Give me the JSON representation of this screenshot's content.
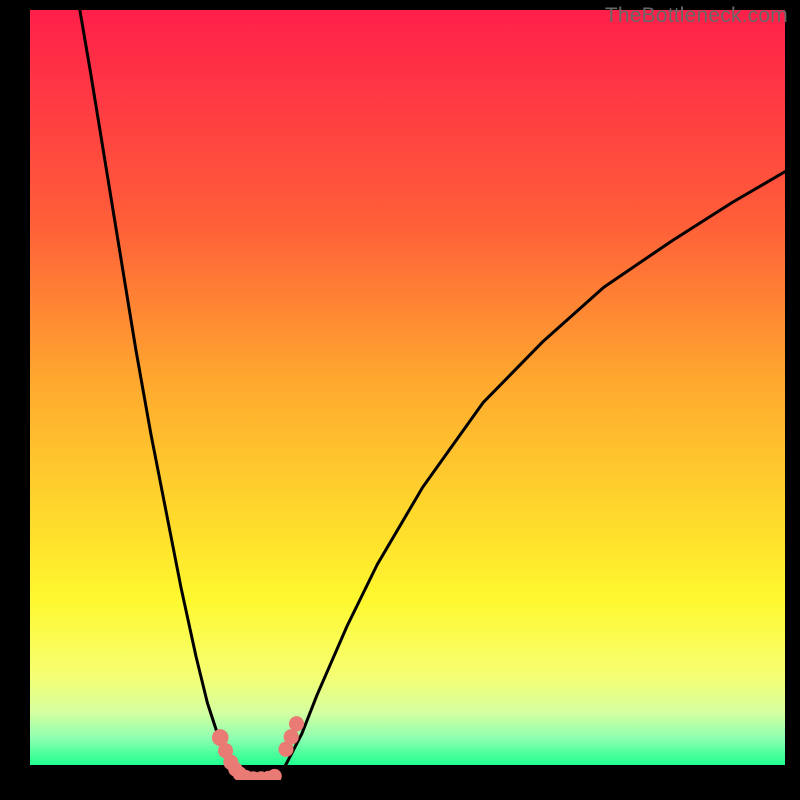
{
  "watermark": "TheBottleneck.com",
  "chart_data": {
    "type": "line",
    "title": "",
    "xlabel": "",
    "ylabel": "",
    "xlim": [
      0,
      100
    ],
    "ylim": [
      0,
      100
    ],
    "grid": false,
    "legend": false,
    "background_gradient": {
      "stops": [
        {
          "pos": 0.0,
          "color": "#ff1f4a"
        },
        {
          "pos": 0.28,
          "color": "#ff5e39"
        },
        {
          "pos": 0.5,
          "color": "#ffab2e"
        },
        {
          "pos": 0.7,
          "color": "#ffe12c"
        },
        {
          "pos": 0.78,
          "color": "#fff82f"
        },
        {
          "pos": 0.88,
          "color": "#f6ff71"
        },
        {
          "pos": 0.93,
          "color": "#d6ffa0"
        },
        {
          "pos": 0.965,
          "color": "#8cffb0"
        },
        {
          "pos": 1.0,
          "color": "#1fff8f"
        }
      ]
    },
    "series": [
      {
        "name": "left-branch",
        "x": [
          6.6,
          8,
          10,
          12,
          14,
          16,
          18,
          20,
          22,
          23.5,
          25,
          26,
          27,
          27.8
        ],
        "y": [
          100,
          92,
          80,
          68,
          56,
          45,
          35,
          25,
          16,
          10,
          5.5,
          3,
          1.3,
          0.5
        ]
      },
      {
        "name": "valley",
        "x": [
          27.8,
          29,
          30.3,
          31.6,
          33
        ],
        "y": [
          0.5,
          0.15,
          0.1,
          0.15,
          0.6
        ]
      },
      {
        "name": "right-branch",
        "x": [
          33,
          34,
          36,
          38,
          42,
          46,
          52,
          60,
          68,
          76,
          85,
          93,
          100
        ],
        "y": [
          0.6,
          2.2,
          6,
          11,
          20,
          28,
          38,
          49,
          57,
          64,
          70,
          75,
          79
        ]
      }
    ],
    "markers": [
      {
        "cx": 25.2,
        "cy": 5.5,
        "r": 1.1
      },
      {
        "cx": 25.9,
        "cy": 3.8,
        "r": 1.0
      },
      {
        "cx": 26.6,
        "cy": 2.3,
        "r": 1.0
      },
      {
        "cx": 27.2,
        "cy": 1.4,
        "r": 0.95
      },
      {
        "cx": 27.8,
        "cy": 0.8,
        "r": 0.95
      },
      {
        "cx": 28.6,
        "cy": 0.35,
        "r": 0.95
      },
      {
        "cx": 29.6,
        "cy": 0.18,
        "r": 0.95
      },
      {
        "cx": 30.6,
        "cy": 0.18,
        "r": 0.95
      },
      {
        "cx": 31.6,
        "cy": 0.25,
        "r": 0.95
      },
      {
        "cx": 32.4,
        "cy": 0.5,
        "r": 0.95
      },
      {
        "cx": 33.9,
        "cy": 4.0,
        "r": 1.0
      },
      {
        "cx": 34.6,
        "cy": 5.6,
        "r": 1.0
      },
      {
        "cx": 35.3,
        "cy": 7.3,
        "r": 1.0
      }
    ],
    "marker_color": "#e97b74",
    "curve_color": "#000000"
  }
}
